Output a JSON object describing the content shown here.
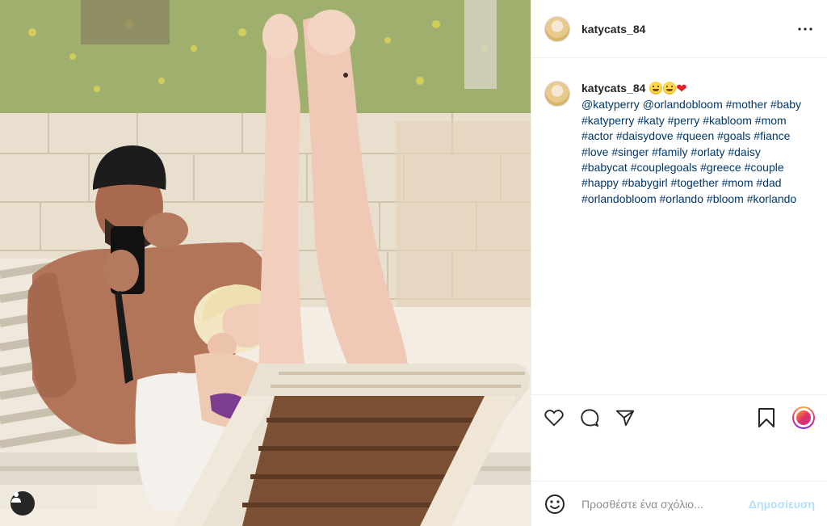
{
  "post": {
    "username": "katycats_84",
    "photo_alt": "",
    "user_tag_icon": "user-tag-icon"
  },
  "header": {
    "username": "katycats_84",
    "more_icon": "more-options-icon"
  },
  "caption": {
    "username": "katycats_84",
    "emojis": [
      "grinning-face",
      "grinning-face",
      "red-heart"
    ],
    "tags": [
      "@katyperry",
      "@orlandobloom",
      "#mother",
      "#baby",
      "#katyperry",
      "#katy",
      "#perry",
      "#kabloom",
      "#mom",
      "#actor",
      "#daisydove",
      "#queen",
      "#goals",
      "#fiance",
      "#love",
      "#singer",
      "#family",
      "#orlaty",
      "#daisy",
      "#babycat",
      "#couplegoals",
      "#greece",
      "#couple",
      "#happy",
      "#babygirl",
      "#together",
      "#mom",
      "#dad",
      "#orlandobloom",
      "#orlando",
      "#bloom",
      "#korlando"
    ]
  },
  "actions": {
    "like_icon": "heart-icon",
    "comment_icon": "comment-icon",
    "share_icon": "share-icon",
    "save_icon": "bookmark-icon"
  },
  "comment": {
    "placeholder": "Προσθέστε ένα σχόλιο...",
    "post_label": "Δημοσίευση"
  },
  "colors": {
    "link": "#00376b",
    "post_button_disabled": "#b2dffc",
    "border": "#efefef"
  }
}
